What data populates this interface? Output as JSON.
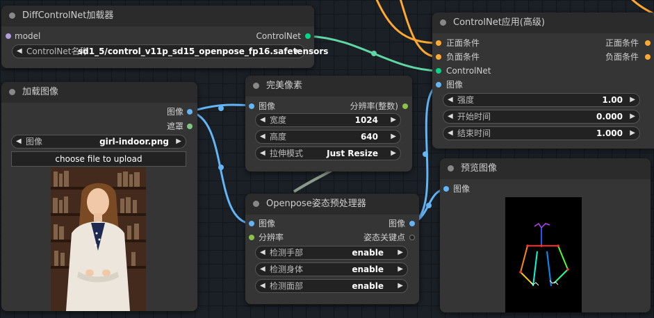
{
  "colors": {
    "conditioning": "#ffa931",
    "controlnet": "#00d78d",
    "image": "#64b5f6",
    "mask": "#81c784",
    "int": "#8bc34a",
    "model": "#b39ddb"
  },
  "nodes": {
    "diffcn": {
      "title": "DiffControlNet加载器",
      "in_model": "model",
      "out_controlnet": "ControlNet",
      "widget_label": "ControlNet名称",
      "widget_value": "sd1_5/control_v11p_sd15_openpose_fp16.safetensors"
    },
    "cnapply": {
      "title": "ControlNet应用(高级)",
      "in_pos": "正面条件",
      "in_neg": "负面条件",
      "in_cn": "ControlNet",
      "in_image": "图像",
      "out_pos": "正面条件",
      "out_neg": "负面条件",
      "w_strength_label": "强度",
      "w_strength_value": "1.00",
      "w_start_label": "开始时间",
      "w_start_value": "0.000",
      "w_end_label": "结束时间",
      "w_end_value": "1.000"
    },
    "loadimg": {
      "title": "加载图像",
      "out_image": "图像",
      "out_mask": "遮罩",
      "widget_label": "图像",
      "widget_value": "girl-indoor.png",
      "upload_button": "choose file to upload"
    },
    "pixel": {
      "title": "完美像素",
      "in_image": "图像",
      "out_res": "分辨率(整数)",
      "w_width_label": "宽度",
      "w_width_value": "1024",
      "w_height_label": "高度",
      "w_height_value": "640",
      "w_mode_label": "拉伸模式",
      "w_mode_value": "Just Resize"
    },
    "openpose": {
      "title": "Openpose姿态预处理器",
      "in_image": "图像",
      "in_res": "分辨率",
      "out_image": "图像",
      "out_kps": "姿态关键点",
      "w_hand_label": "检测手部",
      "w_hand_value": "enable",
      "w_body_label": "检测身体",
      "w_body_value": "enable",
      "w_face_label": "检测面部",
      "w_face_value": "enable"
    },
    "preview": {
      "title": "预览图像",
      "in_image": "图像"
    }
  }
}
